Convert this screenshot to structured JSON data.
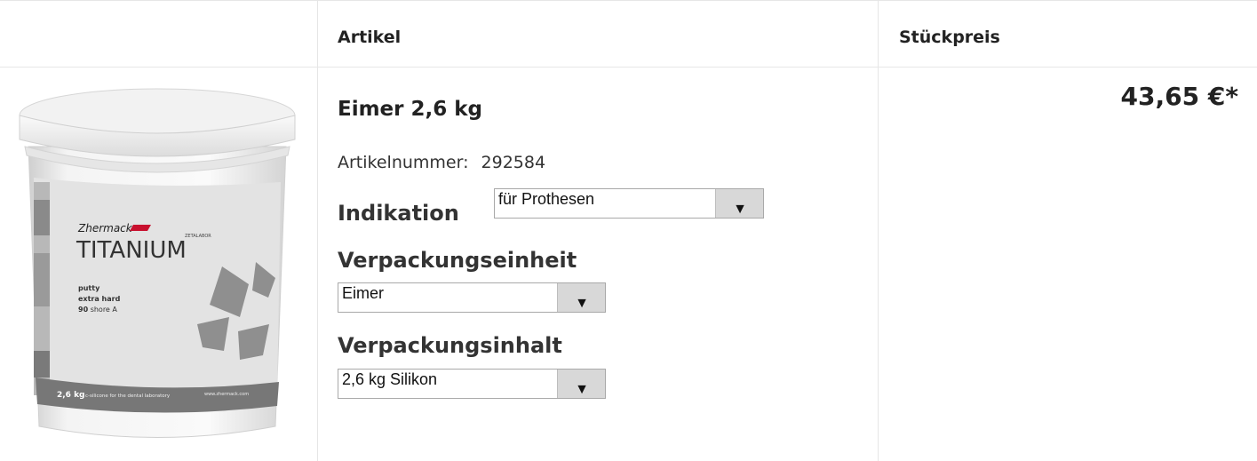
{
  "table": {
    "header_article": "Artikel",
    "header_price": "Stückpreis"
  },
  "product": {
    "title": "Eimer 2,6 kg",
    "artno_label": "Artikelnummer:",
    "artno_value": "292584",
    "price": "43,65 €*",
    "image": {
      "brand": "Zhermack",
      "name": "TITANIUM",
      "subbrand": "ZETALABOR",
      "line1": "putty",
      "line2": "extra hard",
      "line3_bold": "90",
      "line3_rest": "shore A",
      "weight": "2,6 kg",
      "footer": "c-silicone for the dental laboratory",
      "website": "www.zhermack.com"
    }
  },
  "options": {
    "indication": {
      "label": "Indikation",
      "value": "für Prothesen"
    },
    "packing_unit": {
      "label": "Verpackungseinheit",
      "value": "Eimer"
    },
    "packing_content": {
      "label": "Verpackungsinhalt",
      "value": "2,6 kg Silikon"
    }
  },
  "icons": {
    "dropdown": "triangle-down-icon"
  },
  "colors": {
    "border": "#e6e6e6",
    "select_button": "#d8d8d8"
  }
}
